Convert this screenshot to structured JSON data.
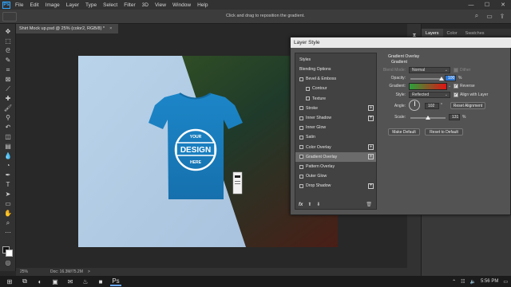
{
  "app": {
    "logo": "Ps",
    "menu": [
      "File",
      "Edit",
      "Image",
      "Layer",
      "Type",
      "Select",
      "Filter",
      "3D",
      "View",
      "Window",
      "Help"
    ],
    "window_controls": [
      "—",
      "☐",
      "✕"
    ]
  },
  "options_bar": {
    "hint": "Click and drag to reposition the gradient."
  },
  "document": {
    "tab_title": "Shirt Mock up.psd @ 25% (color2, RGB/8) *",
    "close_glyph": "×"
  },
  "colors": {
    "accent": "#31a8ff",
    "canvas_light": "#b6d2e6",
    "canvas_dark_green": "#2a4a1e",
    "canvas_dark_red": "#4a1e16",
    "shirt_blue": "#1f7fbf",
    "gradient_start": "#2ba03a",
    "gradient_end": "#e01313"
  },
  "artwork": {
    "logo_text": "DESIGN",
    "logo_top": "YOUR",
    "logo_bottom": "HERE"
  },
  "status": {
    "zoom": "25%",
    "doc_info": "Doc: 16.3M/75.2M",
    "arrow": ">"
  },
  "panels": {
    "tabs": [
      "Layers",
      "Color",
      "Swatches"
    ]
  },
  "dialog": {
    "title": "Layer Style",
    "styles_header": "Styles",
    "items": [
      {
        "label": "Blending Options",
        "checkbox": false,
        "plus": false,
        "indent": false
      },
      {
        "label": "Bevel & Emboss",
        "checkbox": true,
        "plus": false,
        "indent": false
      },
      {
        "label": "Contour",
        "checkbox": true,
        "plus": false,
        "indent": true
      },
      {
        "label": "Texture",
        "checkbox": true,
        "plus": false,
        "indent": true
      },
      {
        "label": "Stroke",
        "checkbox": true,
        "plus": true,
        "indent": false
      },
      {
        "label": "Inner Shadow",
        "checkbox": true,
        "plus": true,
        "indent": false
      },
      {
        "label": "Inner Glow",
        "checkbox": true,
        "plus": false,
        "indent": false
      },
      {
        "label": "Satin",
        "checkbox": true,
        "plus": false,
        "indent": false
      },
      {
        "label": "Color Overlay",
        "checkbox": true,
        "plus": true,
        "indent": false
      },
      {
        "label": "Gradient Overlay",
        "checkbox": true,
        "plus": true,
        "indent": false
      },
      {
        "label": "Pattern Overlay",
        "checkbox": true,
        "plus": false,
        "indent": false
      },
      {
        "label": "Outer Glow",
        "checkbox": true,
        "plus": false,
        "indent": false
      },
      {
        "label": "Drop Shadow",
        "checkbox": true,
        "plus": true,
        "indent": false
      }
    ],
    "footer": {
      "fx": "fx",
      "up": "⬆",
      "down": "⬇",
      "trash": "🗑"
    },
    "section_title": "Gradient Overlay",
    "section_subtitle": "Gradient",
    "blend_mode_label": "Blend Mode:",
    "blend_mode_value": "Normal",
    "dither_label": "Dither",
    "opacity_label": "Opacity:",
    "opacity_value": "100",
    "opacity_unit": "%",
    "gradient_label": "Gradient:",
    "reverse_label": "Reverse",
    "style_label": "Style:",
    "style_value": "Reflected",
    "align_label": "Align with Layer",
    "angle_label": "Angle:",
    "angle_value": "102",
    "angle_unit": "°",
    "reset_alignment": "Reset Alignment",
    "scale_label": "Scale:",
    "scale_value": "131",
    "scale_unit": "%",
    "make_default": "Make Default",
    "reset_default": "Reset to Default"
  },
  "taskbar": {
    "time": "5:56 PM",
    "start_glyph": "⊞",
    "icons": [
      "⊞",
      "⧉",
      "◐",
      "▣",
      "✉",
      "♨",
      "■",
      "Ps"
    ]
  }
}
